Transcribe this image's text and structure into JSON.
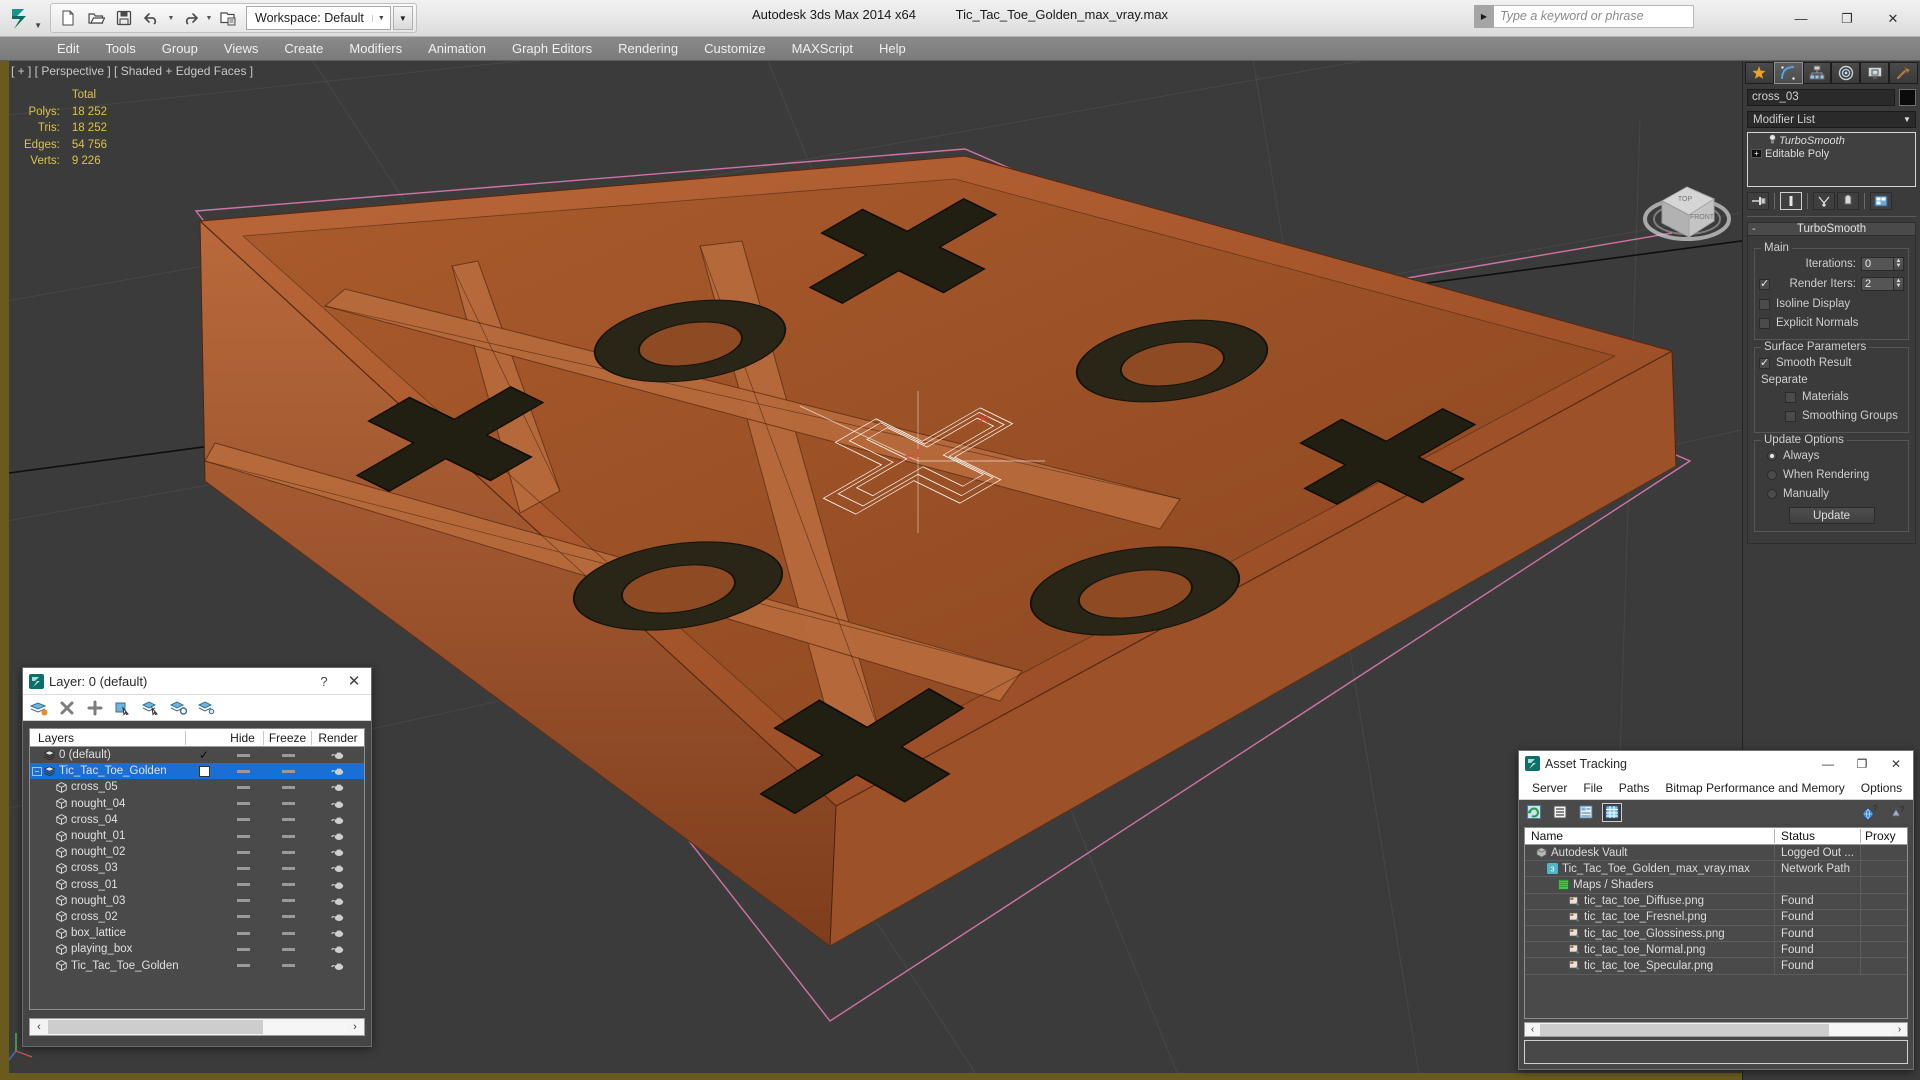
{
  "titlebar": {
    "app_title": "Autodesk 3ds Max  2014 x64",
    "file_title": "Tic_Tac_Toe_Golden_max_vray.max",
    "workspace_label": "Workspace: Default",
    "help_search_placeholder": "Type a keyword or phrase",
    "quick_access": [
      {
        "name": "new-file-icon",
        "label": "New"
      },
      {
        "name": "open-file-icon",
        "label": "Open"
      },
      {
        "name": "save-file-icon",
        "label": "Save"
      },
      {
        "name": "undo-icon",
        "label": "Undo"
      },
      {
        "name": "redo-icon",
        "label": "Redo"
      },
      {
        "name": "set-project-folder-icon",
        "label": "Set Project Folder"
      }
    ],
    "window_controls": [
      {
        "name": "minimize-button",
        "glyph": "—"
      },
      {
        "name": "maximize-button",
        "glyph": "❐"
      },
      {
        "name": "close-button",
        "glyph": "✕"
      }
    ]
  },
  "menubar": {
    "items": [
      "Edit",
      "Tools",
      "Group",
      "Views",
      "Create",
      "Modifiers",
      "Animation",
      "Graph Editors",
      "Rendering",
      "Customize",
      "MAXScript",
      "Help"
    ]
  },
  "viewport": {
    "label": "[ + ] [ Perspective ] [ Shaded + Edged Faces ]",
    "stats_header": "Total",
    "stats": [
      {
        "label": "Polys:",
        "value": "18 252"
      },
      {
        "label": "Tris:",
        "value": "18 252"
      },
      {
        "label": "Edges:",
        "value": "54 756"
      },
      {
        "label": "Verts:",
        "value": "9 226"
      }
    ],
    "viewcube": {
      "front": "FRONT",
      "top": "TOP"
    },
    "colors": {
      "background": "#3b3b3b",
      "stats_text": "#d9c24a",
      "active_border": "#6b5a1e",
      "selection_white": "#ffffff",
      "wood_light": "#c4703a",
      "wood_dark": "#8c4a22",
      "piece_dark": "#2a2617"
    }
  },
  "command_panel": {
    "tabs": [
      {
        "name": "create-tab",
        "icon": "star-icon",
        "active": false
      },
      {
        "name": "modify-tab",
        "icon": "arc-icon",
        "active": true
      },
      {
        "name": "hierarchy-tab",
        "icon": "hierarchy-icon",
        "active": false
      },
      {
        "name": "motion-tab",
        "icon": "wheel-icon",
        "active": false
      },
      {
        "name": "display-tab",
        "icon": "monitor-icon",
        "active": false
      },
      {
        "name": "utilities-tab",
        "icon": "hammer-icon",
        "active": false
      }
    ],
    "object_name": "cross_03",
    "modifier_list_label": "Modifier List",
    "stack": [
      {
        "name": "TurboSmooth",
        "italic": true,
        "icon": "lightbulb-icon"
      },
      {
        "name": "Editable Poly",
        "italic": false,
        "icon": "plus-box-icon"
      }
    ],
    "stack_buttons": [
      {
        "name": "pin-stack-button"
      },
      {
        "name": "show-end-result-button",
        "active": true
      },
      {
        "name": "make-unique-button"
      },
      {
        "name": "remove-modifier-button"
      },
      {
        "name": "configure-modifier-sets-button"
      }
    ],
    "rollout": {
      "title": "TurboSmooth",
      "collapse_glyph": "-",
      "main": {
        "group_label": "Main",
        "iterations_label": "Iterations:",
        "iterations_value": "0",
        "render_iters_label": "Render Iters:",
        "render_iters_value": "2",
        "render_iters_checked": true,
        "isoline_display_label": "Isoline Display",
        "isoline_display_checked": false,
        "explicit_normals_label": "Explicit Normals",
        "explicit_normals_checked": false
      },
      "surface": {
        "group_label": "Surface Parameters",
        "smooth_result_label": "Smooth Result",
        "smooth_result_checked": true,
        "separate_label": "Separate",
        "materials_label": "Materials",
        "materials_checked": false,
        "smoothing_groups_label": "Smoothing Groups",
        "smoothing_groups_checked": false
      },
      "update": {
        "group_label": "Update Options",
        "options": [
          {
            "label": "Always",
            "selected": true
          },
          {
            "label": "When Rendering",
            "selected": false
          },
          {
            "label": "Manually",
            "selected": false
          }
        ],
        "button_label": "Update"
      }
    }
  },
  "layer_dialog": {
    "title": "Layer: 0 (default)",
    "help_glyph": "?",
    "close_glyph": "✕",
    "toolbar": [
      {
        "name": "create-new-layer-icon"
      },
      {
        "name": "delete-layer-icon"
      },
      {
        "name": "add-selection-to-layer-icon"
      },
      {
        "name": "select-objects-in-layer-icon"
      },
      {
        "name": "highlight-selected-objects-icon"
      },
      {
        "name": "hide-unhide-layer-icon"
      },
      {
        "name": "layer-properties-icon"
      }
    ],
    "columns": {
      "name": "Layers",
      "hide": "Hide",
      "freeze": "Freeze",
      "render": "Render"
    },
    "rows": [
      {
        "name": "0 (default)",
        "indent": 1,
        "icon": "layer-icon",
        "selected": false,
        "check": "check",
        "expander": ""
      },
      {
        "name": "Tic_Tac_Toe_Golden",
        "indent": 1,
        "icon": "layer-icon",
        "selected": true,
        "check": "box",
        "expander": "minus"
      },
      {
        "name": "cross_05",
        "indent": 2,
        "icon": "object-icon",
        "selected": false,
        "check": "",
        "expander": ""
      },
      {
        "name": "nought_04",
        "indent": 2,
        "icon": "object-icon",
        "selected": false,
        "check": "",
        "expander": ""
      },
      {
        "name": "cross_04",
        "indent": 2,
        "icon": "object-icon",
        "selected": false,
        "check": "",
        "expander": ""
      },
      {
        "name": "nought_01",
        "indent": 2,
        "icon": "object-icon",
        "selected": false,
        "check": "",
        "expander": ""
      },
      {
        "name": "nought_02",
        "indent": 2,
        "icon": "object-icon",
        "selected": false,
        "check": "",
        "expander": ""
      },
      {
        "name": "cross_03",
        "indent": 2,
        "icon": "object-icon",
        "selected": false,
        "check": "",
        "expander": ""
      },
      {
        "name": "cross_01",
        "indent": 2,
        "icon": "object-icon",
        "selected": false,
        "check": "",
        "expander": ""
      },
      {
        "name": "nought_03",
        "indent": 2,
        "icon": "object-icon",
        "selected": false,
        "check": "",
        "expander": ""
      },
      {
        "name": "cross_02",
        "indent": 2,
        "icon": "object-icon",
        "selected": false,
        "check": "",
        "expander": ""
      },
      {
        "name": "box_lattice",
        "indent": 2,
        "icon": "object-icon",
        "selected": false,
        "check": "",
        "expander": ""
      },
      {
        "name": "playing_box",
        "indent": 2,
        "icon": "object-icon",
        "selected": false,
        "check": "",
        "expander": ""
      },
      {
        "name": "Tic_Tac_Toe_Golden",
        "indent": 2,
        "icon": "object-icon",
        "selected": false,
        "check": "",
        "expander": ""
      }
    ]
  },
  "asset_tracking": {
    "title": "Asset Tracking",
    "window_controls": [
      {
        "name": "at-minimize-button",
        "glyph": "—"
      },
      {
        "name": "at-maximize-button",
        "glyph": "❐"
      },
      {
        "name": "at-close-button",
        "glyph": "✕"
      }
    ],
    "menu": [
      "Server",
      "File",
      "Paths",
      "Bitmap Performance and Memory",
      "Options"
    ],
    "toolbar": [
      {
        "name": "refresh-icon",
        "active": false
      },
      {
        "name": "list-view-icon",
        "active": false
      },
      {
        "name": "details-view-icon",
        "active": false
      },
      {
        "name": "grid-view-icon",
        "active": true
      }
    ],
    "toolbar_right": [
      {
        "name": "help-globe-icon"
      },
      {
        "name": "help-icon"
      }
    ],
    "columns": {
      "name": "Name",
      "status": "Status",
      "proxy": "Proxy"
    },
    "rows": [
      {
        "name": "Autodesk Vault",
        "status": "Logged Out ...",
        "proxy": "",
        "indent": 1,
        "icon": "vault-icon"
      },
      {
        "name": "Tic_Tac_Toe_Golden_max_vray.max",
        "status": "Network Path",
        "proxy": "",
        "indent": 2,
        "icon": "max-file-icon"
      },
      {
        "name": "Maps / Shaders",
        "status": "",
        "proxy": "",
        "indent": 3,
        "icon": "maps-icon"
      },
      {
        "name": "tic_tac_toe_Diffuse.png",
        "status": "Found",
        "proxy": "",
        "indent": 4,
        "icon": "bitmap-icon"
      },
      {
        "name": "tic_tac_toe_Fresnel.png",
        "status": "Found",
        "proxy": "",
        "indent": 4,
        "icon": "bitmap-icon"
      },
      {
        "name": "tic_tac_toe_Glossiness.png",
        "status": "Found",
        "proxy": "",
        "indent": 4,
        "icon": "bitmap-icon"
      },
      {
        "name": "tic_tac_toe_Normal.png",
        "status": "Found",
        "proxy": "",
        "indent": 4,
        "icon": "bitmap-icon"
      },
      {
        "name": "tic_tac_toe_Specular.png",
        "status": "Found",
        "proxy": "",
        "indent": 4,
        "icon": "bitmap-icon"
      }
    ],
    "scroll_arrows": {
      "left": "‹",
      "right": "›"
    }
  }
}
